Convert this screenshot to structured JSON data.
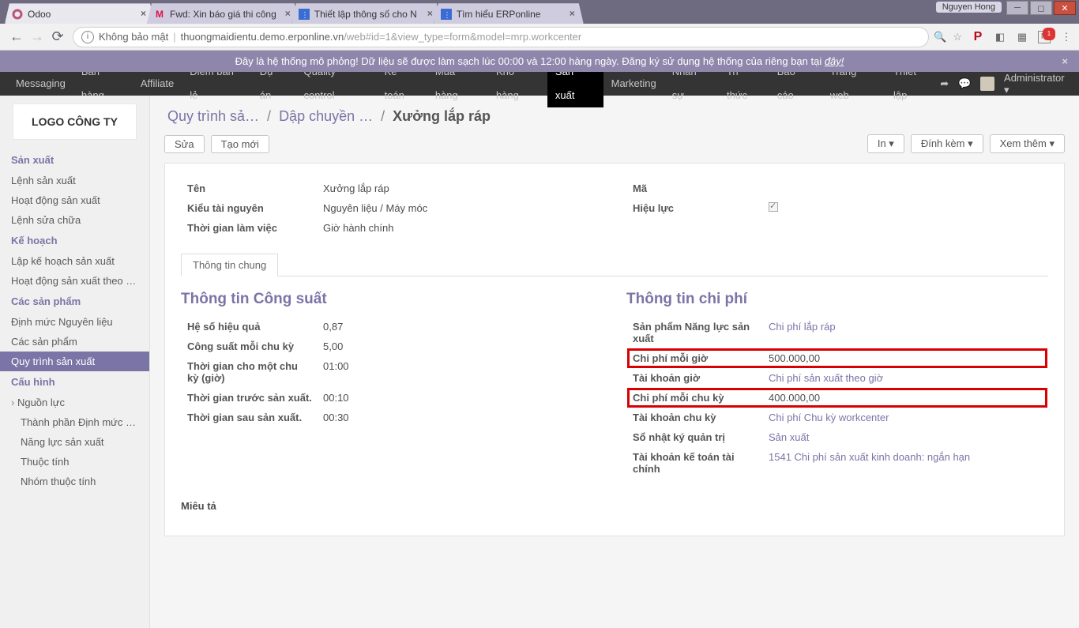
{
  "browser": {
    "tabs": [
      {
        "title": "Odoo",
        "active": true,
        "fav": "odoo"
      },
      {
        "title": "Fwd: Xin báo giá thi công",
        "active": false,
        "fav": "gmail"
      },
      {
        "title": "Thiết lập thông số cho N",
        "active": false,
        "fav": "erp"
      },
      {
        "title": "Tìm hiểu ERPonline",
        "active": false,
        "fav": "erp"
      }
    ],
    "user_badge": "Nguyen Hong",
    "security": "Không bảo mật",
    "host": "thuongmaidientu.demo.erponline.vn",
    "path": "/web#id=1&view_type=form&model=mrp.workcenter"
  },
  "banner": {
    "text": "Đây là hệ thống mô phỏng! Dữ liệu sẽ được làm sạch lúc 00:00 và 12:00 hàng ngày. Đăng ký sử dụng hệ thống của riêng bạn tại ",
    "link": "đây!"
  },
  "topnav": {
    "items": [
      "Messaging",
      "Bán hàng",
      "Affiliate",
      "Điểm bán lẻ",
      "Dự án",
      "Quality control",
      "Kế toán",
      "Mua hàng",
      "Kho hàng",
      "Sản xuất",
      "Marketing",
      "Nhân sự",
      "Tri thức",
      "Báo cáo",
      "Trang web",
      "Thiết lập"
    ],
    "active": "Sản xuất",
    "user": "Administrator"
  },
  "sidebar": {
    "logo": "LOGO CÔNG TY",
    "groups": [
      {
        "header": "Sản xuất",
        "items": [
          "Lệnh sản xuất",
          "Hoạt động sản xuất",
          "Lệnh sửa chữa"
        ]
      },
      {
        "header": "Kế hoạch",
        "items": [
          "Lập kế hoạch sản xuất",
          "Hoạt động sản xuất theo N…"
        ]
      },
      {
        "header": "Các sản phẩm",
        "items": [
          "Định mức Nguyên liệu",
          "Các sản phẩm",
          "Quy trình sản xuất"
        ]
      },
      {
        "header": "Cấu hình",
        "items": [
          "Nguồn lực",
          "Thành phần Định mức ngu…",
          "Năng lực sản xuất",
          "Thuộc tính",
          "Nhóm thuộc tính"
        ]
      }
    ],
    "selected": "Quy trình sản xuất",
    "sub_expanded": "Nguồn lực"
  },
  "breadcrumb": [
    "Quy trình sả…",
    "Dập chuyền …",
    "Xưởng lắp ráp"
  ],
  "buttons": {
    "edit": "Sửa",
    "create": "Tạo mới",
    "print": "In",
    "attach": "Đính kèm",
    "more": "Xem thêm"
  },
  "form": {
    "fields": {
      "name_label": "Tên",
      "name": "Xưởng lắp ráp",
      "resource_label": "Kiểu tài nguyên",
      "resource": "Nguyên liệu / Máy móc",
      "work_label": "Thời gian làm việc",
      "work": "Giờ hành chính",
      "code_label": "Mã",
      "code": "",
      "active_label": "Hiệu lực"
    },
    "tab": "Thông tin chung",
    "left_section": "Thông tin Công suất",
    "left": {
      "eff_label": "Hệ số hiệu quả",
      "eff": "0,87",
      "cap_label": "Công suất mỗi chu kỳ",
      "cap": "5,00",
      "cycle_label": "Thời gian cho một chu kỳ (giờ)",
      "cycle": "01:00",
      "before_label": "Thời gian trước sản xuất.",
      "before": "00:10",
      "after_label": "Thời gian sau sản xuất.",
      "after": "00:30"
    },
    "right_section": "Thông tin chi phí",
    "right": {
      "product_label": "Sản phẩm Năng lực sản xuất",
      "product": "Chi phí lắp ráp",
      "hour_label": "Chi phí mỗi giờ",
      "hour": "500.000,00",
      "hour_acc_label": "Tài khoản giờ",
      "hour_acc": "Chi phí sản xuất theo giờ",
      "cycle_cost_label": "Chi phí mỗi chu kỳ",
      "cycle_cost": "400.000,00",
      "cycle_acc_label": "Tài khoản chu kỳ",
      "cycle_acc": "Chi phí Chu kỳ workcenter",
      "journal_label": "Sổ nhật ký quản trị",
      "journal": "Sản xuất",
      "fin_acc_label": "Tài khoản kế toán tài chính",
      "fin_acc": "1541 Chi phí sản xuất kinh doanh: ngắn hạn"
    },
    "desc_label": "Miêu tả"
  }
}
